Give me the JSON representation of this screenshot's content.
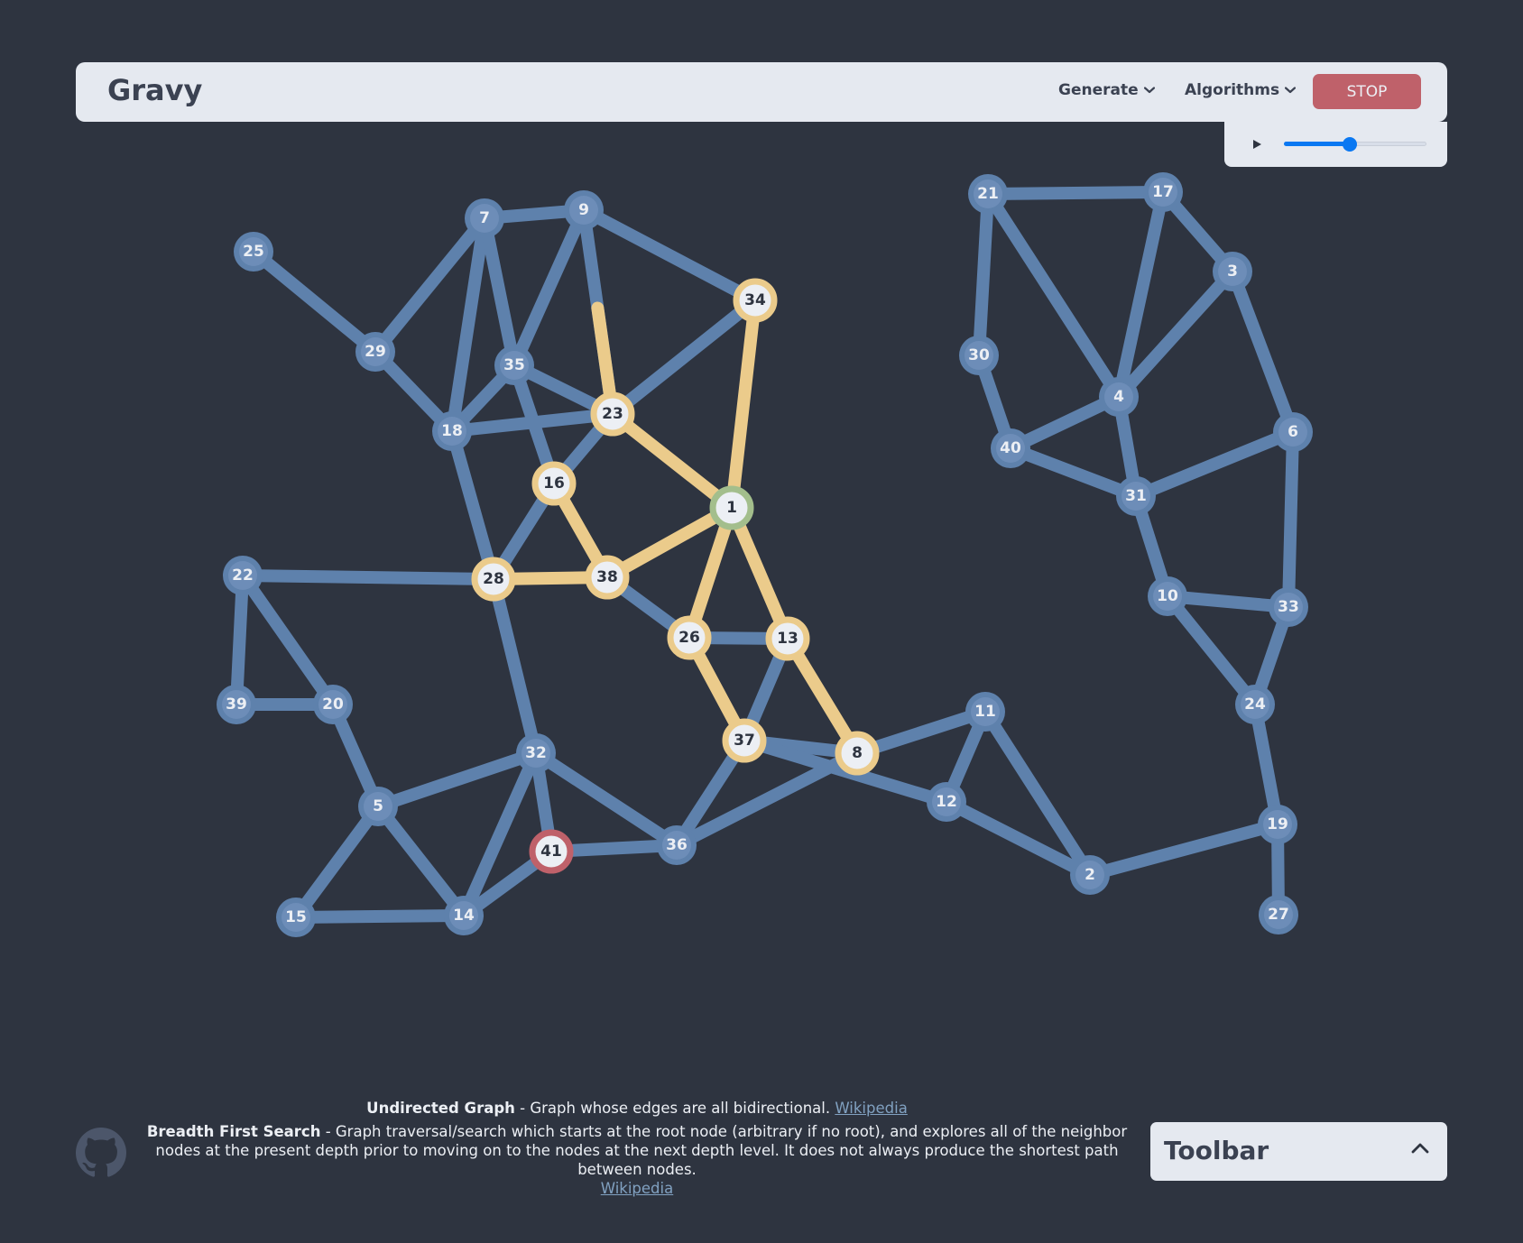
{
  "header": {
    "title": "Gravy",
    "menus": [
      {
        "label": "Generate"
      },
      {
        "label": "Algorithms"
      }
    ],
    "stop_label": "STOP"
  },
  "controls": {
    "play_icon": "play-icon",
    "speed_fraction": 0.46
  },
  "colors": {
    "background": "#2e3440",
    "default": "#5e81ac",
    "visited": "#ebcb8b",
    "start": "#a3be8c",
    "target": "#bf616a",
    "node_fill": "#eceff4"
  },
  "graph": {
    "nodes": [
      {
        "id": "1",
        "state": "start"
      },
      {
        "id": "2",
        "state": "default"
      },
      {
        "id": "3",
        "state": "default"
      },
      {
        "id": "4",
        "state": "default"
      },
      {
        "id": "5",
        "state": "default"
      },
      {
        "id": "6",
        "state": "default"
      },
      {
        "id": "7",
        "state": "default"
      },
      {
        "id": "8",
        "state": "visited"
      },
      {
        "id": "9",
        "state": "default"
      },
      {
        "id": "10",
        "state": "default"
      },
      {
        "id": "11",
        "state": "default"
      },
      {
        "id": "12",
        "state": "default"
      },
      {
        "id": "13",
        "state": "visited"
      },
      {
        "id": "14",
        "state": "default"
      },
      {
        "id": "15",
        "state": "default"
      },
      {
        "id": "16",
        "state": "visited"
      },
      {
        "id": "17",
        "state": "default"
      },
      {
        "id": "18",
        "state": "default"
      },
      {
        "id": "19",
        "state": "default"
      },
      {
        "id": "20",
        "state": "default"
      },
      {
        "id": "21",
        "state": "default"
      },
      {
        "id": "22",
        "state": "default"
      },
      {
        "id": "23",
        "state": "visited"
      },
      {
        "id": "24",
        "state": "default"
      },
      {
        "id": "25",
        "state": "default"
      },
      {
        "id": "26",
        "state": "visited"
      },
      {
        "id": "27",
        "state": "default"
      },
      {
        "id": "28",
        "state": "visited"
      },
      {
        "id": "29",
        "state": "default"
      },
      {
        "id": "30",
        "state": "default"
      },
      {
        "id": "31",
        "state": "default"
      },
      {
        "id": "32",
        "state": "default"
      },
      {
        "id": "33",
        "state": "default"
      },
      {
        "id": "34",
        "state": "visited"
      },
      {
        "id": "35",
        "state": "default"
      },
      {
        "id": "36",
        "state": "default"
      },
      {
        "id": "37",
        "state": "visited"
      },
      {
        "id": "38",
        "state": "visited"
      },
      {
        "id": "39",
        "state": "default"
      },
      {
        "id": "40",
        "state": "default"
      },
      {
        "id": "41",
        "state": "target"
      }
    ],
    "edges": [
      {
        "a": "25",
        "b": "29",
        "state": "default"
      },
      {
        "a": "29",
        "b": "7",
        "state": "default"
      },
      {
        "a": "29",
        "b": "18",
        "state": "default"
      },
      {
        "a": "7",
        "b": "9",
        "state": "default"
      },
      {
        "a": "7",
        "b": "18",
        "state": "default"
      },
      {
        "a": "7",
        "b": "35",
        "state": "default"
      },
      {
        "a": "9",
        "b": "35",
        "state": "default"
      },
      {
        "a": "9",
        "b": "34",
        "state": "default"
      },
      {
        "a": "9",
        "b": "23",
        "state": "partial",
        "progress": 0.52
      },
      {
        "a": "35",
        "b": "18",
        "state": "default"
      },
      {
        "a": "35",
        "b": "23",
        "state": "default"
      },
      {
        "a": "35",
        "b": "16",
        "state": "default"
      },
      {
        "a": "18",
        "b": "23",
        "state": "default"
      },
      {
        "a": "18",
        "b": "28",
        "state": "default"
      },
      {
        "a": "23",
        "b": "34",
        "state": "default"
      },
      {
        "a": "23",
        "b": "16",
        "state": "default"
      },
      {
        "a": "23",
        "b": "1",
        "state": "visited"
      },
      {
        "a": "34",
        "b": "1",
        "state": "visited"
      },
      {
        "a": "16",
        "b": "28",
        "state": "default"
      },
      {
        "a": "16",
        "b": "38",
        "state": "visited"
      },
      {
        "a": "1",
        "b": "38",
        "state": "visited"
      },
      {
        "a": "1",
        "b": "26",
        "state": "visited"
      },
      {
        "a": "1",
        "b": "13",
        "state": "visited"
      },
      {
        "a": "38",
        "b": "28",
        "state": "visited"
      },
      {
        "a": "38",
        "b": "26",
        "state": "default"
      },
      {
        "a": "26",
        "b": "13",
        "state": "default"
      },
      {
        "a": "26",
        "b": "37",
        "state": "visited"
      },
      {
        "a": "13",
        "b": "37",
        "state": "default"
      },
      {
        "a": "13",
        "b": "8",
        "state": "visited"
      },
      {
        "a": "22",
        "b": "28",
        "state": "default"
      },
      {
        "a": "22",
        "b": "39",
        "state": "default"
      },
      {
        "a": "22",
        "b": "20",
        "state": "default"
      },
      {
        "a": "39",
        "b": "20",
        "state": "default"
      },
      {
        "a": "20",
        "b": "5",
        "state": "default"
      },
      {
        "a": "28",
        "b": "32",
        "state": "default"
      },
      {
        "a": "32",
        "b": "5",
        "state": "default"
      },
      {
        "a": "32",
        "b": "14",
        "state": "default"
      },
      {
        "a": "32",
        "b": "41",
        "state": "default"
      },
      {
        "a": "32",
        "b": "36",
        "state": "default"
      },
      {
        "a": "5",
        "b": "15",
        "state": "default"
      },
      {
        "a": "5",
        "b": "14",
        "state": "default"
      },
      {
        "a": "15",
        "b": "14",
        "state": "default"
      },
      {
        "a": "14",
        "b": "41",
        "state": "default"
      },
      {
        "a": "41",
        "b": "36",
        "state": "default"
      },
      {
        "a": "36",
        "b": "37",
        "state": "default"
      },
      {
        "a": "36",
        "b": "8",
        "state": "default"
      },
      {
        "a": "37",
        "b": "8",
        "state": "default"
      },
      {
        "a": "37",
        "b": "12",
        "state": "default"
      },
      {
        "a": "8",
        "b": "11",
        "state": "default"
      },
      {
        "a": "11",
        "b": "12",
        "state": "default"
      },
      {
        "a": "11",
        "b": "2",
        "state": "default"
      },
      {
        "a": "12",
        "b": "2",
        "state": "default"
      },
      {
        "a": "2",
        "b": "19",
        "state": "default"
      },
      {
        "a": "19",
        "b": "27",
        "state": "default"
      },
      {
        "a": "19",
        "b": "24",
        "state": "default"
      },
      {
        "a": "24",
        "b": "10",
        "state": "default"
      },
      {
        "a": "24",
        "b": "33",
        "state": "default"
      },
      {
        "a": "10",
        "b": "33",
        "state": "default"
      },
      {
        "a": "10",
        "b": "31",
        "state": "default"
      },
      {
        "a": "33",
        "b": "6",
        "state": "default"
      },
      {
        "a": "6",
        "b": "31",
        "state": "default"
      },
      {
        "a": "6",
        "b": "3",
        "state": "default"
      },
      {
        "a": "3",
        "b": "17",
        "state": "default"
      },
      {
        "a": "3",
        "b": "4",
        "state": "default"
      },
      {
        "a": "17",
        "b": "21",
        "state": "default"
      },
      {
        "a": "17",
        "b": "4",
        "state": "default"
      },
      {
        "a": "21",
        "b": "4",
        "state": "default"
      },
      {
        "a": "21",
        "b": "30",
        "state": "default"
      },
      {
        "a": "30",
        "b": "40",
        "state": "default"
      },
      {
        "a": "40",
        "b": "4",
        "state": "default"
      },
      {
        "a": "40",
        "b": "31",
        "state": "default"
      },
      {
        "a": "4",
        "b": "31",
        "state": "default"
      }
    ]
  },
  "footer": {
    "graph_type_title": "Undirected Graph",
    "graph_type_desc": " - Graph whose edges are all bidirectional. ",
    "algo_title": "Breadth First Search",
    "algo_desc": " - Graph traversal/search which starts at the root node (arbitrary if no root), and explores all of the neighbor nodes at the present depth prior to moving on to the nodes at the next depth level. It does not always produce the shortest path between nodes.",
    "link_label": "Wikipedia",
    "github_icon": "github-icon"
  },
  "toolbar": {
    "label": "Toolbar",
    "chevron_icon": "chevron-up-icon"
  }
}
